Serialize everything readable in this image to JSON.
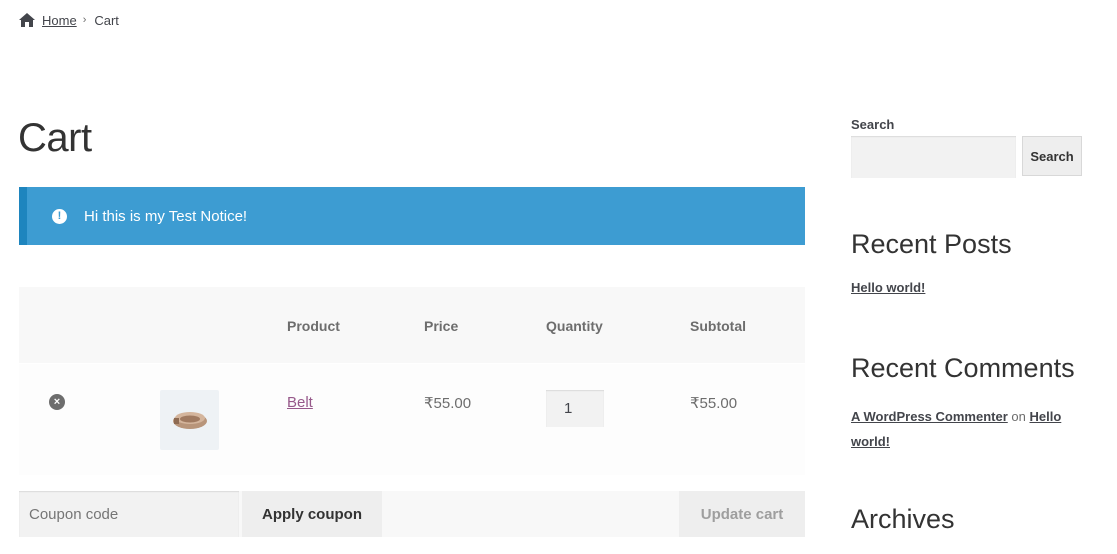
{
  "breadcrumb": {
    "home": "Home",
    "separator": "›",
    "current": "Cart",
    "home_icon": "home-icon"
  },
  "page": {
    "title": "Cart"
  },
  "notice": {
    "message": "Hi this is my Test Notice!",
    "icon": "info-icon",
    "bg": "#3d9cd2"
  },
  "cart": {
    "headers": [
      "Product",
      "Price",
      "Quantity",
      "Subtotal"
    ],
    "items": [
      {
        "remove_glyph": "×",
        "thumb_icon": "belt-image",
        "product": "Belt",
        "price": "₹55.00",
        "quantity": "1",
        "subtotal": "₹55.00"
      }
    ],
    "coupon_placeholder": "Coupon code",
    "apply_label": "Apply coupon",
    "update_label": "Update cart"
  },
  "sidebar": {
    "search_label": "Search",
    "search_button": "Search",
    "recent_posts_title": "Recent Posts",
    "recent_posts": [
      "Hello world!"
    ],
    "recent_comments_title": "Recent Comments",
    "recent_comment": {
      "author": "A WordPress Commenter",
      "on": "on",
      "post": "Hello world!"
    },
    "archives_title": "Archives"
  }
}
